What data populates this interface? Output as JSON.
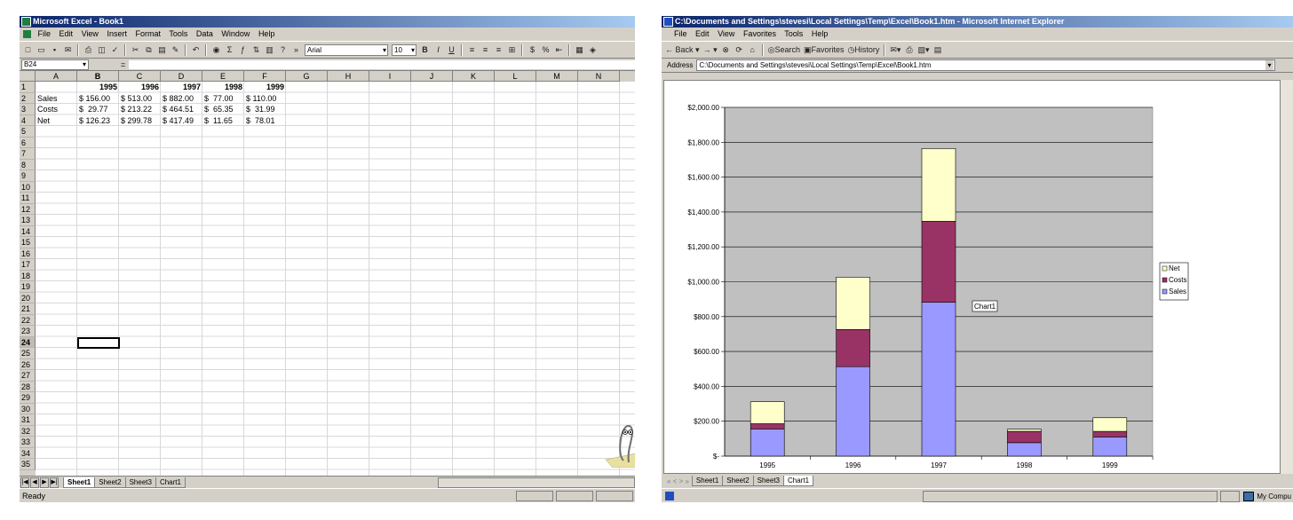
{
  "excel": {
    "title": "Microsoft Excel - Book1",
    "menu": [
      "File",
      "Edit",
      "View",
      "Insert",
      "Format",
      "Tools",
      "Data",
      "Window",
      "Help"
    ],
    "font_name": "Arial",
    "font_size": "10",
    "name_box": "B24",
    "formula_eq": "=",
    "columns": [
      "A",
      "B",
      "C",
      "D",
      "E",
      "F",
      "G",
      "H",
      "I",
      "J",
      "K",
      "L",
      "M",
      "N"
    ],
    "active_column": "B",
    "row_count": 35,
    "active_row": 24,
    "year_headers": [
      "1995",
      "1996",
      "1997",
      "1998",
      "1999"
    ],
    "rows": [
      {
        "label": "Sales",
        "values": [
          "$ 156.00",
          "$ 513.00",
          "$ 882.00",
          "$  77.00",
          "$ 110.00"
        ]
      },
      {
        "label": "Costs",
        "values": [
          "$  29.77",
          "$ 213.22",
          "$ 464.51",
          "$  65.35",
          "$  31.99"
        ]
      },
      {
        "label": "Net",
        "values": [
          "$ 126.23",
          "$ 299.78",
          "$ 417.49",
          "$  11.65",
          "$  78.01"
        ]
      }
    ],
    "sheet_tabs": [
      "Sheet1",
      "Sheet2",
      "Sheet3",
      "Chart1"
    ],
    "active_tab": "Sheet1",
    "status": "Ready"
  },
  "ie": {
    "title": "C:\\Documents and Settings\\stevesi\\Local Settings\\Temp\\Excel\\Book1.htm - Microsoft Internet Explorer",
    "menu": [
      "File",
      "Edit",
      "View",
      "Favorites",
      "Tools",
      "Help"
    ],
    "toolbar": {
      "back": "Back",
      "search": "Search",
      "favorites": "Favorites",
      "history": "History"
    },
    "address_label": "Address",
    "address": "C:\\Documents and Settings\\stevesi\\Local Settings\\Temp\\Excel\\Book1.htm",
    "sheet_nav": "« < > »",
    "sheet_tabs": [
      "Sheet1",
      "Sheet2",
      "Sheet3",
      "Chart1"
    ],
    "active_tab": "Chart1",
    "status_zone": "My Compu",
    "chart_name_label": "Chart1"
  },
  "colors": {
    "sales": "#9999ff",
    "costs": "#993366",
    "net": "#ffffcc",
    "plot_area": "#c0c0c0"
  },
  "chart_data": {
    "type": "bar",
    "stacked": true,
    "categories": [
      "1995",
      "1996",
      "1997",
      "1998",
      "1999"
    ],
    "series": [
      {
        "name": "Sales",
        "values": [
          156.0,
          513.0,
          882.0,
          77.0,
          110.0
        ]
      },
      {
        "name": "Costs",
        "values": [
          29.77,
          213.22,
          464.51,
          65.35,
          31.99
        ]
      },
      {
        "name": "Net",
        "values": [
          126.23,
          299.78,
          417.49,
          11.65,
          78.01
        ]
      }
    ],
    "ytick_labels": [
      "$-",
      "$200.00",
      "$400.00",
      "$600.00",
      "$800.00",
      "$1,000.00",
      "$1,200.00",
      "$1,400.00",
      "$1,600.00",
      "$1,800.00",
      "$2,000.00"
    ],
    "ylim": [
      0,
      2000
    ],
    "ytick_step": 200,
    "grid": true,
    "legend_order": [
      "Net",
      "Costs",
      "Sales"
    ],
    "legend_position": "right"
  }
}
